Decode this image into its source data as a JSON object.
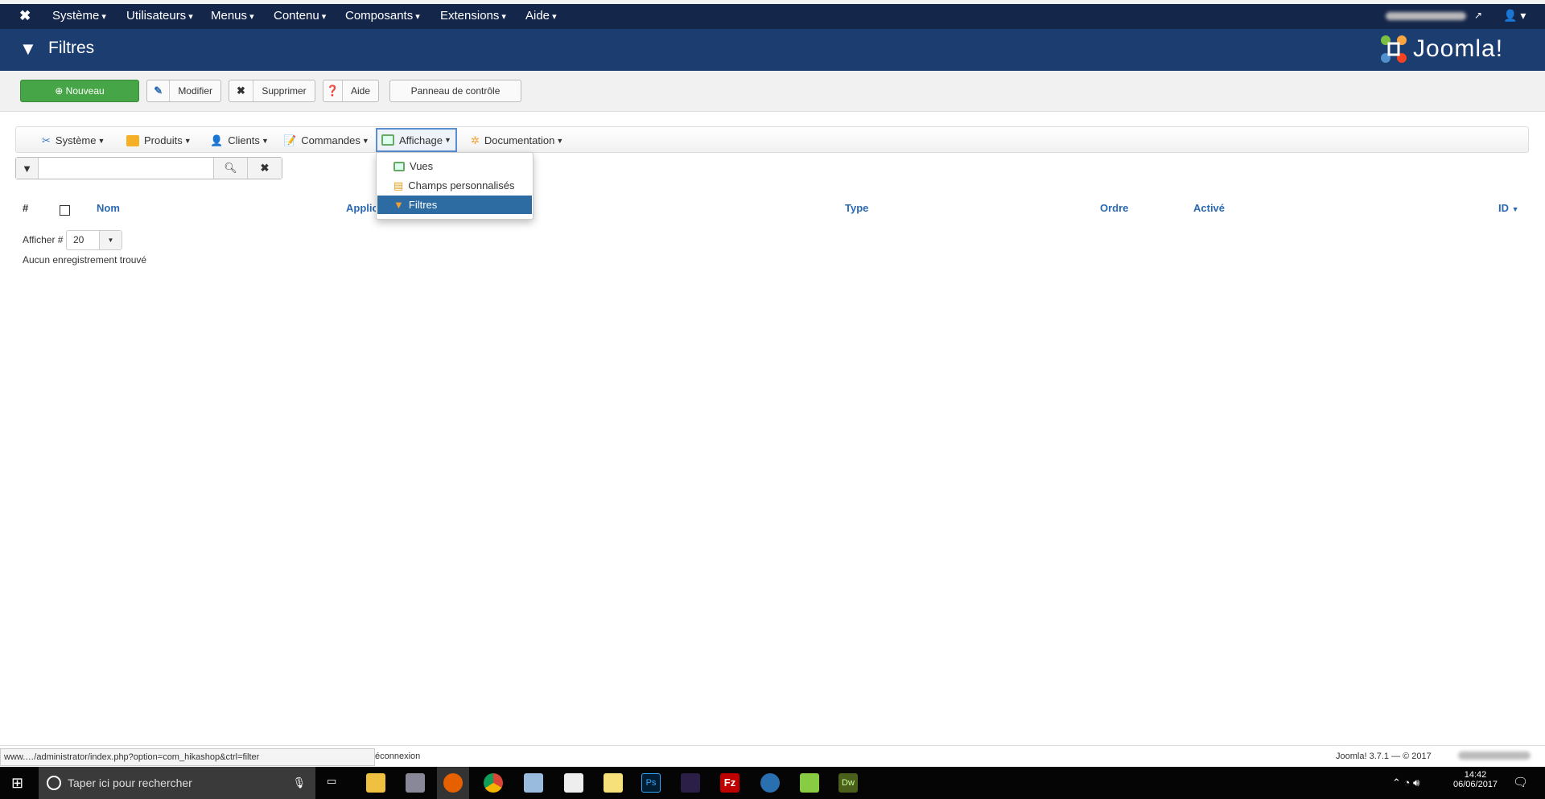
{
  "navbar": {
    "items": [
      "Système",
      "Utilisateurs",
      "Menus",
      "Contenu",
      "Composants",
      "Extensions",
      "Aide"
    ]
  },
  "header": {
    "title": "Filtres",
    "brand": "Joomla!"
  },
  "toolbar": {
    "new": "Nouveau",
    "edit": "Modifier",
    "delete": "Supprimer",
    "help": "Aide",
    "panel": "Panneau de contrôle"
  },
  "menu": {
    "items": [
      "Système",
      "Produits",
      "Clients",
      "Commandes",
      "Affichage",
      "Documentation"
    ],
    "active": "Affichage"
  },
  "dropdown": {
    "items": [
      "Vues",
      "Champs personnalisés",
      "Filtres"
    ],
    "selected": "Filtres"
  },
  "search": {
    "value": "",
    "placeholder": ""
  },
  "table": {
    "columns": {
      "num": "#",
      "name": "Nom",
      "application": "Applic",
      "type": "Type",
      "order": "Ordre",
      "enabled": "Activé",
      "id": "ID"
    }
  },
  "list": {
    "limit_label": "Afficher #",
    "limit_value": "20",
    "empty": "Aucun enregistrement trouvé"
  },
  "footer": {
    "url": "www.…/administrator/index.php?option=com_hikashop&ctrl=filter",
    "logout": "éconnexion",
    "version": "Joomla! 3.7.1 — © 2017"
  },
  "taskbar": {
    "search_placeholder": "Taper ici pour rechercher",
    "time": "14:42",
    "date": "06/06/2017"
  },
  "colors": {
    "navbar": "#14264a",
    "header": "#1c3d70",
    "new_button": "#46a546",
    "link": "#2a69b0",
    "selected": "#2d6ca2"
  }
}
